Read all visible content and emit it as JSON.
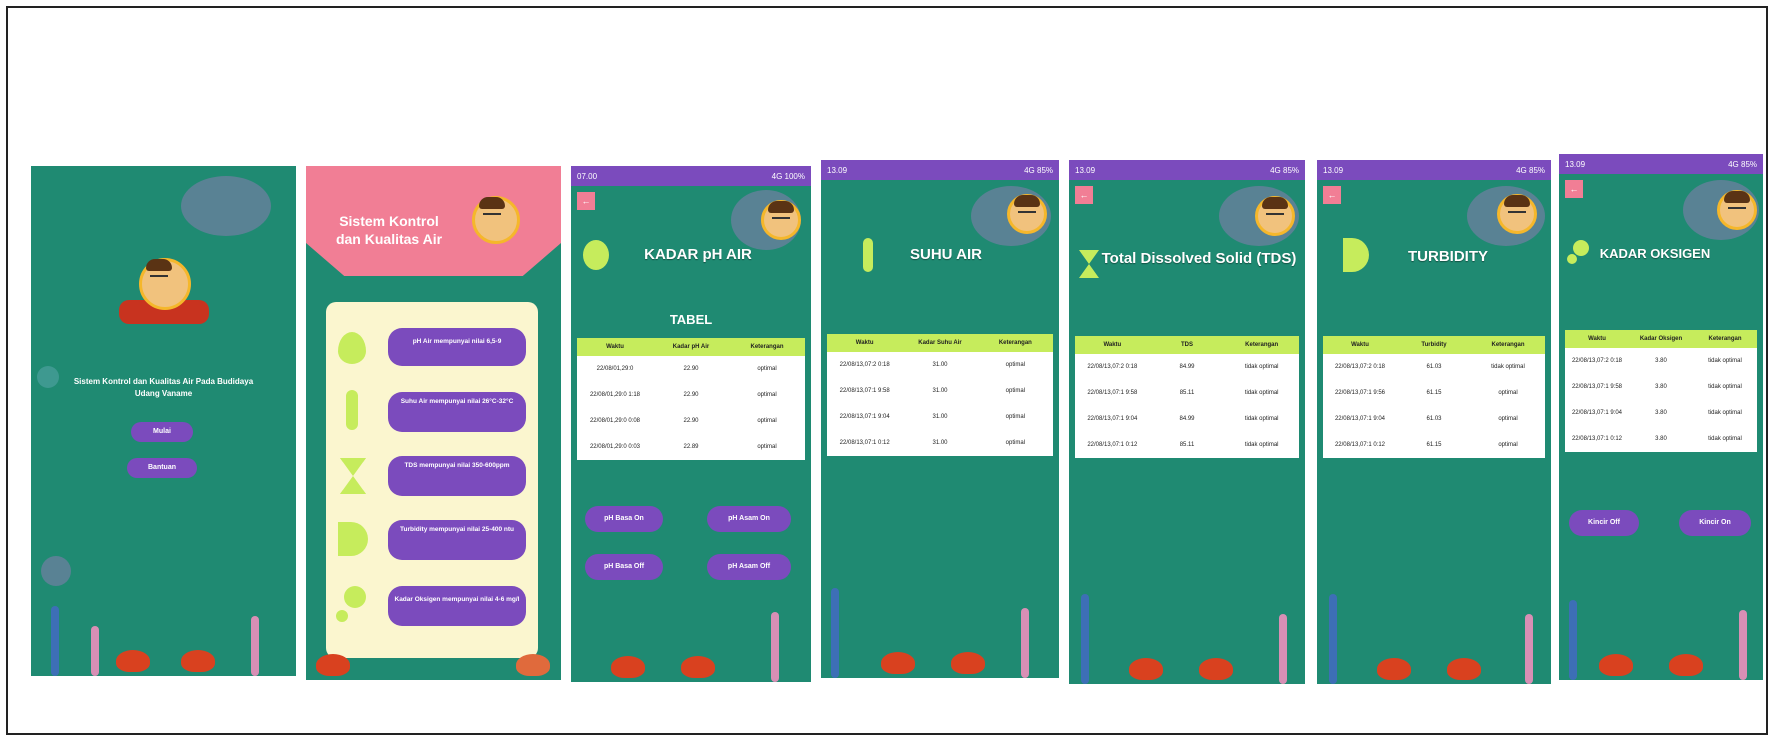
{
  "screens": {
    "splash": {
      "app_title": "Sistem Kontrol dan Kualitas Air Pada Budidaya Udang Vaname",
      "start_button": "Mulai",
      "help_button": "Bantuan"
    },
    "menu": {
      "header_title": "Sistem Kontrol dan Kualitas Air",
      "items": [
        {
          "label": "pH Air mempunyai nilai 6,5-9",
          "icon": "droplet-icon"
        },
        {
          "label": "Suhu Air mempunyai nilai 26°C-32°C",
          "icon": "thermometer-icon"
        },
        {
          "label": "TDS mempunyai nilai 350-600ppm",
          "icon": "hourglass-icon"
        },
        {
          "label": "Turbidity mempunyai nilai 25-400 ntu",
          "icon": "turbidity-icon"
        },
        {
          "label": "Kadar Oksigen mempunyai nilai 4-6 mg/l",
          "icon": "bubbles-icon"
        }
      ]
    },
    "ph": {
      "status_time": "07.00",
      "status_right": "4G 100%",
      "title": "KADAR pH AIR",
      "table_caption": "TABEL",
      "columns": [
        "Waktu",
        "Kadar pH Air",
        "Keterangan"
      ],
      "rows": [
        [
          "22/08/01,29:0",
          "22.90",
          "optimal"
        ],
        [
          "22/08/01,29:0 1:18",
          "22.90",
          "optimal"
        ],
        [
          "22/08/01,29:0 0:08",
          "22.90",
          "optimal"
        ],
        [
          "22/08/01,29:0 0:03",
          "22.89",
          "optimal"
        ]
      ],
      "buttons": [
        "pH Basa On",
        "pH Asam On",
        "pH Basa Off",
        "pH Asam Off"
      ]
    },
    "suhu": {
      "status_time": "13.09",
      "status_right": "4G 85%",
      "title": "SUHU AIR",
      "columns": [
        "Waktu",
        "Kadar Suhu Air",
        "Keterangan"
      ],
      "rows": [
        [
          "22/08/13,07:2 0:18",
          "31.00",
          "optimal"
        ],
        [
          "22/08/13,07:1 9:58",
          "31.00",
          "optimal"
        ],
        [
          "22/08/13,07:1 9:04",
          "31.00",
          "optimal"
        ],
        [
          "22/08/13,07:1 0:12",
          "31.00",
          "optimal"
        ]
      ]
    },
    "tds": {
      "status_time": "13.09",
      "status_right": "4G 85%",
      "title": "Total Dissolved Solid (TDS)",
      "columns": [
        "Waktu",
        "TDS",
        "Keterangan"
      ],
      "rows": [
        [
          "22/08/13,07:2 0:18",
          "84.99",
          "tidak optimal"
        ],
        [
          "22/08/13,07:1 9:58",
          "85.11",
          "tidak optimal"
        ],
        [
          "22/08/13,07:1 9:04",
          "84.99",
          "tidak optimal"
        ],
        [
          "22/08/13,07:1 0:12",
          "85.11",
          "tidak optimal"
        ]
      ]
    },
    "turbidity": {
      "status_time": "13.09",
      "status_right": "4G 85%",
      "title": "TURBIDITY",
      "columns": [
        "Waktu",
        "Turbidity",
        "Keterangan"
      ],
      "rows": [
        [
          "22/08/13,07:2 0:18",
          "61.03",
          "tidak optimal"
        ],
        [
          "22/08/13,07:1 9:56",
          "61.15",
          "optimal"
        ],
        [
          "22/08/13,07:1 9:04",
          "61.03",
          "optimal"
        ],
        [
          "22/08/13,07:1 0:12",
          "61.15",
          "optimal"
        ]
      ]
    },
    "oksigen": {
      "status_time": "13.09",
      "status_right": "4G 85%",
      "title": "KADAR OKSIGEN",
      "columns": [
        "Waktu",
        "Kadar Oksigen",
        "Keterangan"
      ],
      "rows": [
        [
          "22/08/13,07:2 0:18",
          "3.80",
          "tidak optimal"
        ],
        [
          "22/08/13,07:1 9:58",
          "3.80",
          "tidak optimal"
        ],
        [
          "22/08/13,07:1 9:04",
          "3.80",
          "tidak optimal"
        ],
        [
          "22/08/13,07:1 0:12",
          "3.80",
          "tidak optimal"
        ]
      ],
      "buttons": [
        "Kincir Off",
        "Kincir On"
      ]
    }
  },
  "colors": {
    "background": "#1f8a72",
    "status_bar": "#7b4bbd",
    "accent_pink": "#f17e95",
    "table_header": "#c6ec5c",
    "icon_green": "#c6ec5c",
    "button_purple": "#7b4bbd"
  }
}
